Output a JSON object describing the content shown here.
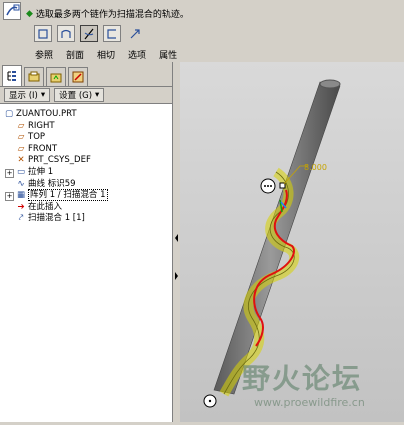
{
  "toolbar": {
    "prompt": "选取最多两个链作为扫描混合的轨迹。",
    "tabs": [
      "参照",
      "剖面",
      "相切",
      "选项",
      "属性"
    ],
    "tools": [
      {
        "icon": "section-rect-icon"
      },
      {
        "icon": "section-curve-icon"
      },
      {
        "icon": "trajectory-icon",
        "active": true
      },
      {
        "icon": "section-open-icon"
      },
      {
        "icon": "scale-arrow-icon"
      }
    ]
  },
  "panel": {
    "show_label": "显示 (I)",
    "settings_label": "设置 (G)",
    "tree": [
      {
        "label": "ZUANTOU.PRT",
        "icon": "part-icon",
        "indent": 0
      },
      {
        "label": "RIGHT",
        "icon": "datum-plane-icon",
        "indent": 1
      },
      {
        "label": "TOP",
        "icon": "datum-plane-icon",
        "indent": 1
      },
      {
        "label": "FRONT",
        "icon": "datum-plane-icon",
        "indent": 1
      },
      {
        "label": "PRT_CSYS_DEF",
        "icon": "csys-icon",
        "indent": 1
      },
      {
        "label": "拉伸 1",
        "icon": "extrude-icon",
        "indent": 1,
        "expand": true
      },
      {
        "label": "曲线 标识59",
        "icon": "curve-icon",
        "indent": 1
      },
      {
        "label": "阵列 1 / 扫描混合 1",
        "icon": "pattern-icon",
        "indent": 1,
        "expand": true,
        "selected": true
      },
      {
        "label": "在此插入",
        "icon": "insert-here-icon",
        "indent": 1
      },
      {
        "label": "扫描混合 1 [1]",
        "icon": "sweep-blend-icon",
        "indent": 1
      }
    ]
  },
  "viewport": {
    "dimension": "8.000",
    "watermark": "野火论坛",
    "watermark_url": "www.proewildfire.cn"
  },
  "colors": {
    "accent": "#1a8a1a",
    "trajectory": "#e01010",
    "highlight": "#d8d400"
  }
}
